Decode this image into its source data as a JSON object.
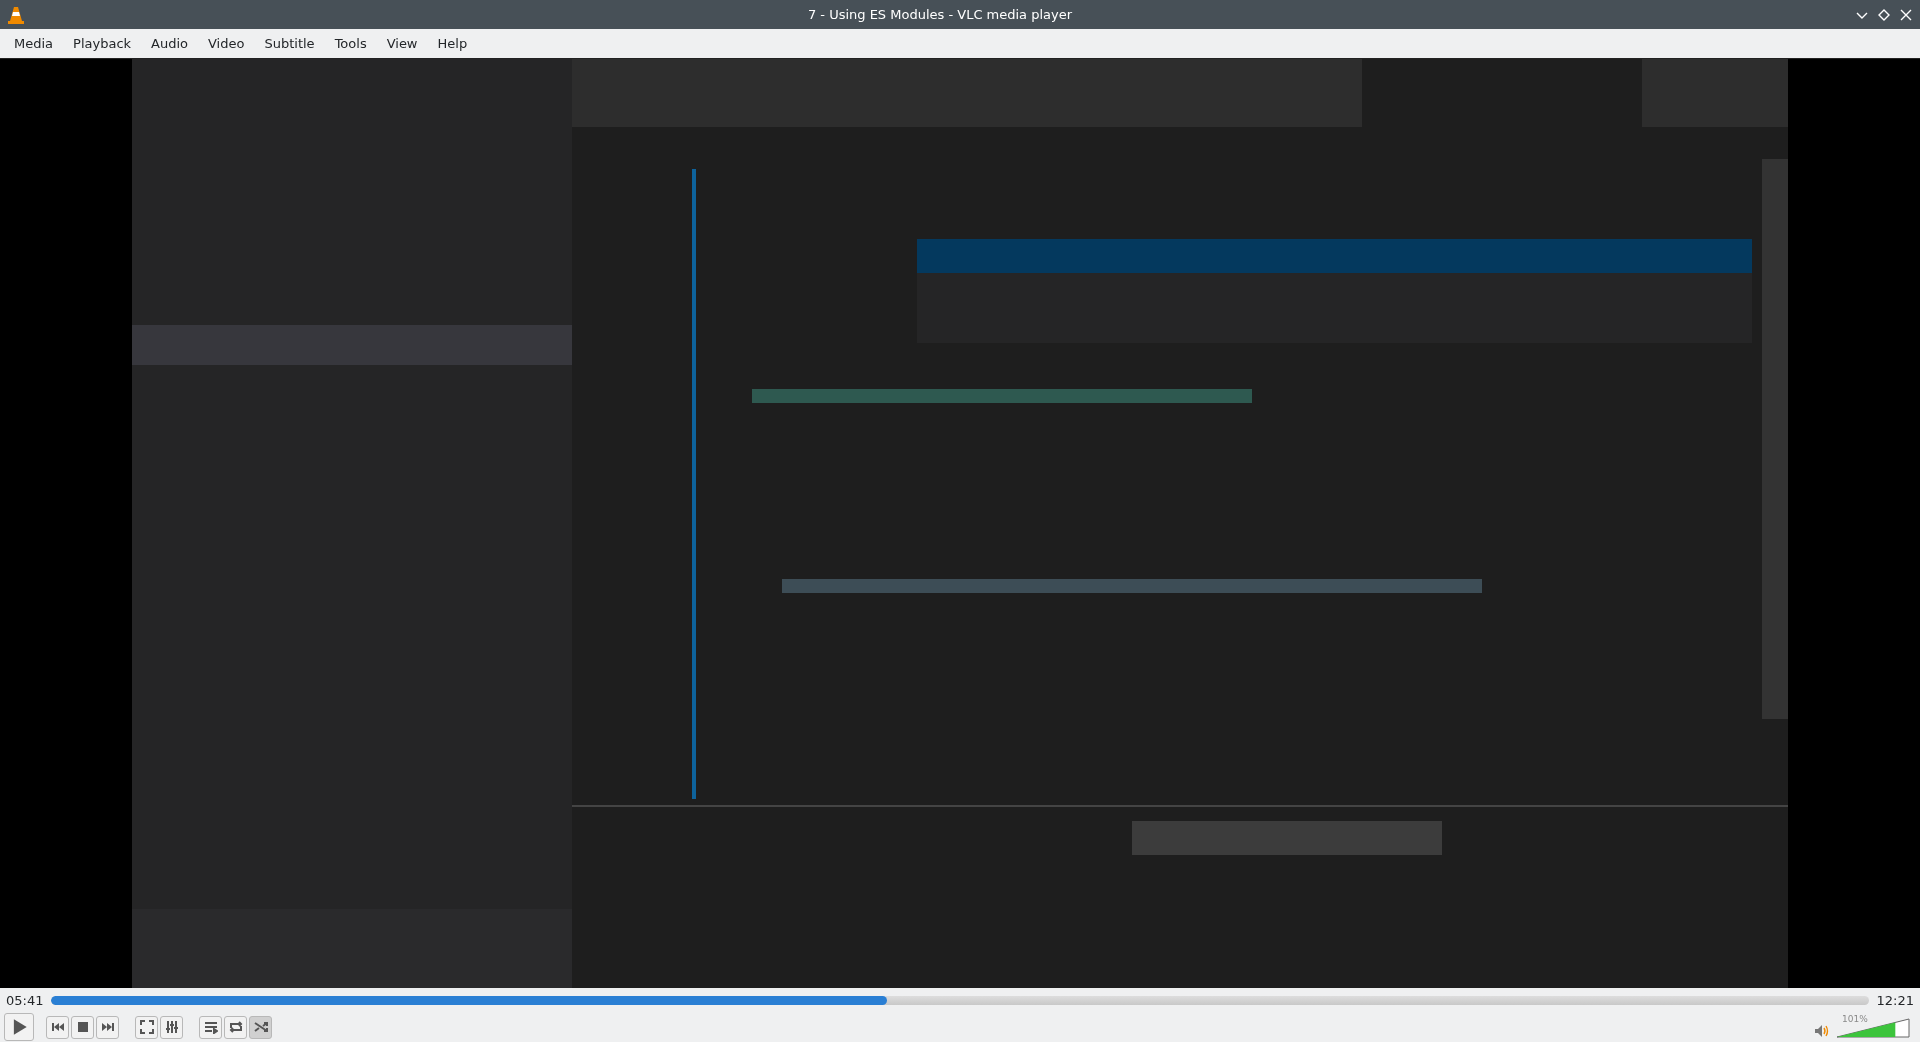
{
  "window": {
    "title": "7 - Using ES Modules - VLC media player"
  },
  "menu": [
    "Media",
    "Playback",
    "Audio",
    "Video",
    "Subtitle",
    "Tools",
    "View",
    "Help"
  ],
  "video": {
    "kind": "picture"
  },
  "progress": {
    "elapsed": "05:41",
    "total": "12:21",
    "level": 0.46
  },
  "controls": [
    {
      "kind": "play",
      "selected": false
    },
    {
      "kind": "previous",
      "selected": false
    },
    {
      "kind": "stop",
      "selected": false
    },
    {
      "kind": "next",
      "selected": false
    },
    {
      "kind": "fullscreen",
      "selected": false
    },
    {
      "kind": "settings",
      "selected": false
    },
    {
      "kind": "playlist",
      "selected": false
    },
    {
      "kind": "loop",
      "selected": false
    },
    {
      "kind": "shuffle",
      "selected": true
    }
  ],
  "volume": {
    "reading": "101%",
    "level": 0.81
  }
}
